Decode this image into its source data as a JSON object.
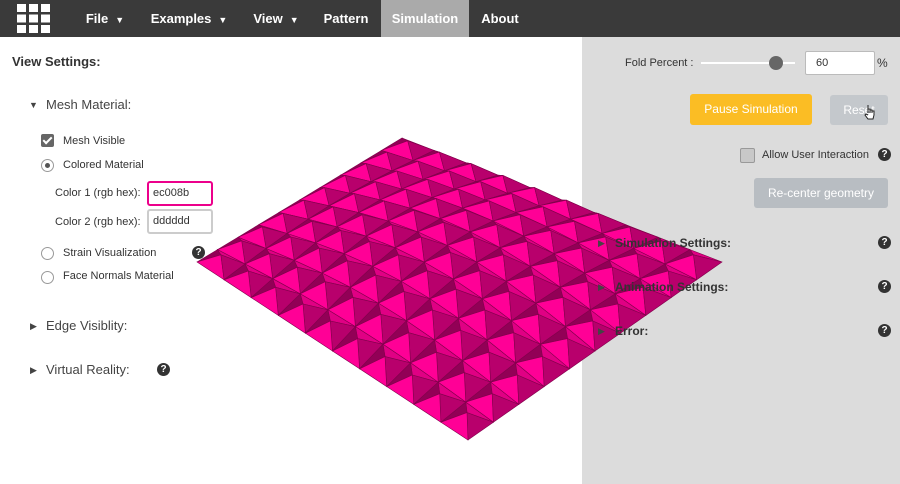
{
  "nav": {
    "items": [
      {
        "label": "File",
        "dropdown": true
      },
      {
        "label": "Examples",
        "dropdown": true
      },
      {
        "label": "View",
        "dropdown": true
      },
      {
        "label": "Pattern",
        "dropdown": false
      },
      {
        "label": "Simulation",
        "dropdown": false,
        "active": true
      },
      {
        "label": "About",
        "dropdown": false
      }
    ]
  },
  "view_settings": {
    "title": "View Settings:",
    "mesh_material": {
      "label": "Mesh Material:",
      "mesh_visible": {
        "label": "Mesh Visible",
        "checked": true
      },
      "colored_material": {
        "label": "Colored Material",
        "selected": true
      },
      "color1": {
        "label": "Color 1 (rgb hex):",
        "value": "ec008b"
      },
      "color2": {
        "label": "Color 2 (rgb hex):",
        "value": "dddddd"
      },
      "strain_visualization": {
        "label": "Strain Visualization",
        "selected": false
      },
      "face_normals": {
        "label": "Face Normals Material",
        "selected": false
      }
    },
    "edge_visibility": {
      "label": "Edge Visiblity:"
    },
    "virtual_reality": {
      "label": "Virtual Reality:"
    }
  },
  "simulation": {
    "fold_percent_label": "Fold Percent :",
    "fold_percent_value": "60",
    "fold_percent_unit": "%",
    "fold_percent_fraction": 0.6,
    "pause_label": "Pause Simulation",
    "reset_label": "Reset",
    "allow_interaction_label": "Allow User Interaction",
    "recenter_label": "Re-center geometry",
    "sections": [
      {
        "label": "Simulation Settings:"
      },
      {
        "label": "Animation Settings:"
      },
      {
        "label": "Error:"
      }
    ]
  },
  "help_glyph": "?",
  "colors": {
    "mesh": "#ec008b",
    "accent": "#fbbd24",
    "topbar": "#3a3a3a",
    "panel": "#dcdcdc"
  },
  "icons": {
    "logo": "grid-logo-icon",
    "cursor": "hand-cursor-icon"
  }
}
